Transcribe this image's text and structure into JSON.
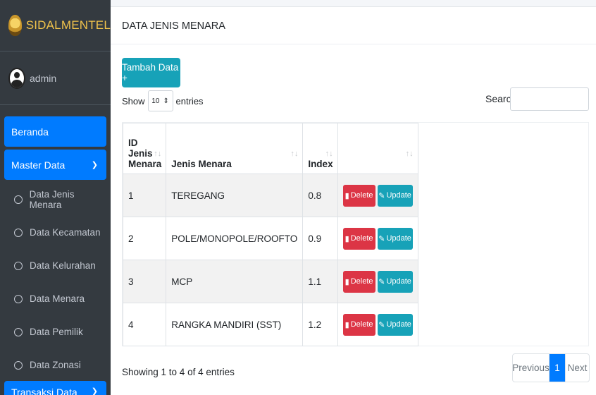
{
  "sidebar": {
    "brand": "SIDALMENTEL",
    "user": "admin",
    "items": [
      {
        "label": "Beranda"
      },
      {
        "label": "Master Data"
      }
    ],
    "sub_items": [
      {
        "label": "Data Jenis Menara"
      },
      {
        "label": "Data Kecamatan"
      },
      {
        "label": "Data Kelurahan"
      },
      {
        "label": "Data Menara"
      },
      {
        "label": "Data Pemilik"
      },
      {
        "label": "Data Zonasi"
      }
    ],
    "partial_item": "Transaksi Data"
  },
  "main": {
    "title": "DATA JENIS MENARA",
    "add_button": "Tambah Data +",
    "show_label": "Show",
    "page_length": "10",
    "entries_label": "entries",
    "search_label": "Search:",
    "columns": [
      "ID Jenis Menara",
      "Jenis Menara",
      "Index",
      ""
    ],
    "rows": [
      {
        "id": "1",
        "name": "TEREGANG",
        "index": "0.8"
      },
      {
        "id": "2",
        "name": "POLE/MONOPOLE/ROOFTO",
        "index": "0.9"
      },
      {
        "id": "3",
        "name": "MCP",
        "index": "1.1"
      },
      {
        "id": "4",
        "name": "RANGKA MANDIRI (SST)",
        "index": "1.2"
      }
    ],
    "delete_label": "Delete",
    "update_label": "Update",
    "info": "Showing 1 to 4 of 4 entries",
    "pager": {
      "previous": "Previous",
      "current": "1",
      "next": "Next"
    }
  },
  "colors": {
    "sidebar": "#343a40",
    "primary": "#007bff",
    "info": "#17a2b8",
    "danger": "#dc3545",
    "brand": "#f0c24b"
  }
}
